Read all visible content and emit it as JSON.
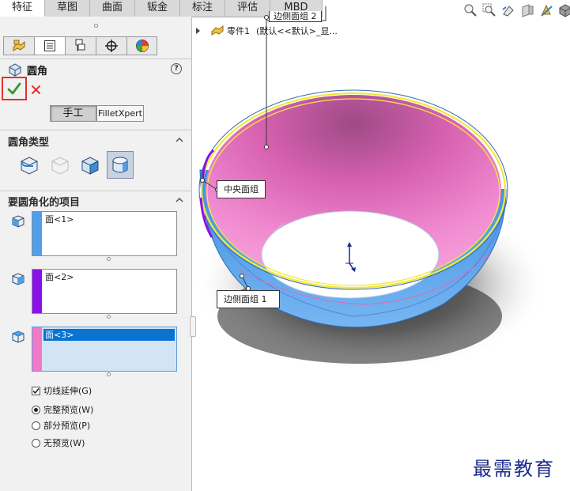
{
  "tabs": [
    {
      "label": "特征",
      "active": true
    },
    {
      "label": "草图"
    },
    {
      "label": "曲面"
    },
    {
      "label": "钣金"
    },
    {
      "label": "标注"
    },
    {
      "label": "评估"
    },
    {
      "label": "MBD"
    }
  ],
  "manager_tabs": [
    "feature-manager-icon",
    "property-manager-icon",
    "configuration-manager-icon",
    "dimxpert-icon",
    "display-manager-icon"
  ],
  "feature": {
    "title": "圆角",
    "help": "?",
    "mode_manual": "手工",
    "mode_expert": "FilletXpert"
  },
  "fillet_type": {
    "header": "圆角类型",
    "options": [
      "constant-size-fillet",
      "variable-size-fillet",
      "face-fillet",
      "full-round-fillet"
    ],
    "selected_index": 3
  },
  "items": {
    "header": "要圆角化的项目",
    "face_sets": [
      {
        "value": "面<1>",
        "color": "#4f9fea"
      },
      {
        "value": "面<2>",
        "color": "#8a10e8"
      },
      {
        "value": "面<3>",
        "color": "#f07ac6",
        "active": true
      }
    ]
  },
  "options": {
    "tangent": {
      "label": "切线延伸(G)",
      "checked": true
    },
    "previews": [
      {
        "label": "完整预览(W)",
        "selected": true
      },
      {
        "label": "部分预览(P)",
        "selected": false
      },
      {
        "label": "无预览(W)",
        "selected": false
      }
    ]
  },
  "tree": {
    "label": "零件1",
    "config": "(默认<<默认>_显..."
  },
  "callouts": {
    "top": "边侧面组 2",
    "center": "中央面组",
    "side": "边侧面组 1"
  },
  "watermark": "最需教育",
  "colors": {
    "accent_ok": "#2f9a2f",
    "cancel": "#e2332a",
    "bowl_inner": "#ee76c6",
    "bowl_outer": "#4f9fea",
    "edge": "#f4e83a"
  }
}
